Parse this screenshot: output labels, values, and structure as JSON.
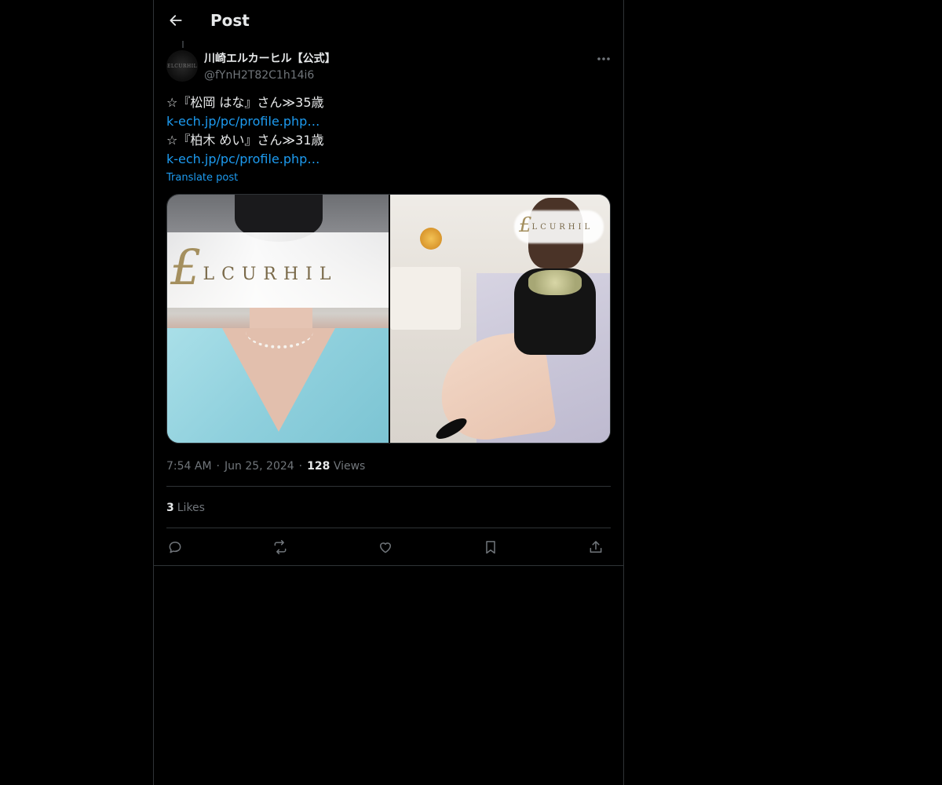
{
  "header": {
    "title": "Post",
    "back_icon": "back-arrow-icon"
  },
  "post": {
    "author": {
      "display_name": "川崎エルカーヒル【公式】",
      "handle": "@fYnH2T82C1h14i6",
      "avatar_text": "ELCURHIL"
    },
    "more_icon": "more-horizontal-icon",
    "text_lines": [
      "☆『松岡 はな』さん≫35歳",
      " k-ech.jp/pc/profile.php…",
      "☆『柏木 めい』さん≫31歳",
      "k-ech.jp/pc/profile.php…"
    ],
    "translate_label": "Translate post",
    "media": {
      "photo1": {
        "logo_crest": "£",
        "logo_word": "LCURHIL"
      },
      "photo2": {
        "logo_crest": "£",
        "logo_word": "LCURHIL"
      }
    },
    "timestamp": {
      "time": "7:54 AM",
      "separator": "·",
      "date": "Jun 25, 2024",
      "views_count": "128",
      "views_label": "Views"
    },
    "likes": {
      "count": "3",
      "label": "Likes"
    }
  },
  "actions": [
    {
      "name": "reply",
      "icon": "reply-icon"
    },
    {
      "name": "repost",
      "icon": "repost-icon"
    },
    {
      "name": "like",
      "icon": "heart-icon"
    },
    {
      "name": "bookmark",
      "icon": "bookmark-icon"
    },
    {
      "name": "share",
      "icon": "share-icon"
    }
  ],
  "colors": {
    "background": "#000000",
    "text_primary": "#e7e9ea",
    "text_secondary": "#71767b",
    "link": "#1d9bf0",
    "border": "#2f3336"
  }
}
